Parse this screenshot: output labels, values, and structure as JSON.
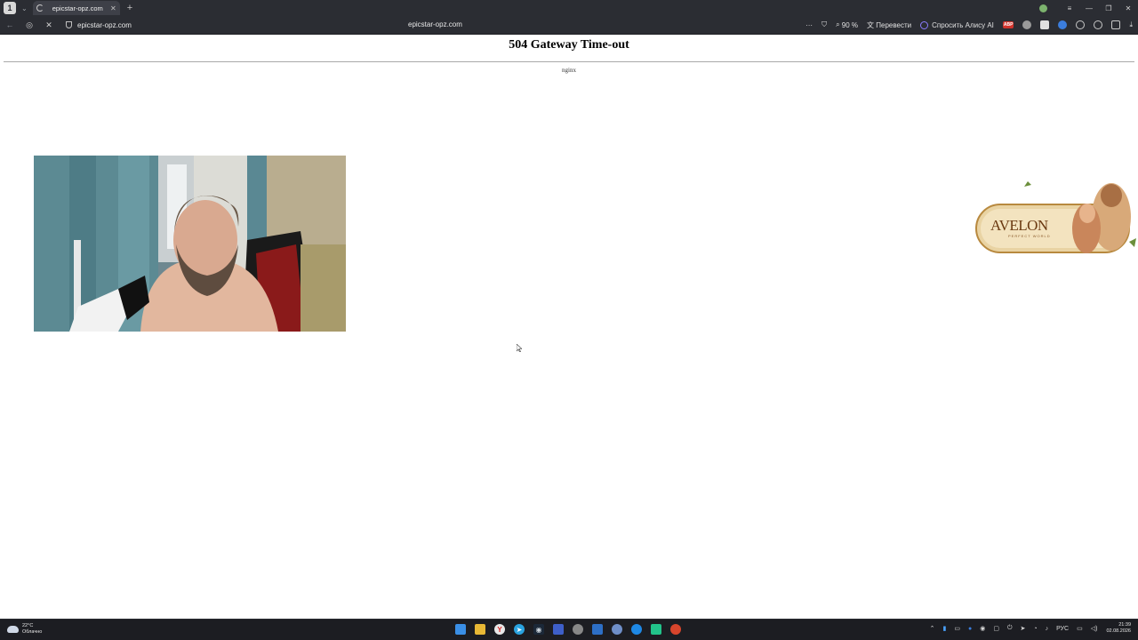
{
  "browser": {
    "profile_initial": "1",
    "tab": {
      "title": "epicstar-opz.com"
    },
    "new_tab_symbol": "+",
    "address": {
      "site": "epicstar-opz.com",
      "center_text": "epicstar-opz.com"
    },
    "toolbar": {
      "more": "···",
      "zoom": "90 %",
      "translate": "Перевести",
      "alice": "Спросить Алису AI",
      "abp": "ABP"
    }
  },
  "page": {
    "title": "504 Gateway Time-out",
    "server": "nginx"
  },
  "banner": {
    "brand": "AVELON",
    "tagline": "PERFECT WORLD"
  },
  "taskbar": {
    "weather": {
      "temp": "22°C",
      "condition": "Облачно"
    },
    "lang": "РУС",
    "time": "21:39",
    "date": "02.08.2026"
  }
}
